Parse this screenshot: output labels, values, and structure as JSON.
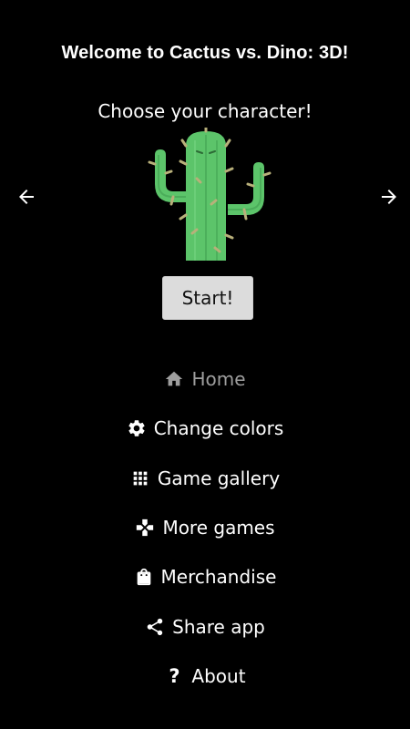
{
  "header": {
    "title": "Welcome to Cactus vs. Dino: 3D!",
    "subtitle": "Choose your character!"
  },
  "character_picker": {
    "prev_icon": "arrow-left-icon",
    "next_icon": "arrow-right-icon",
    "current_character_icon": "cactus-icon",
    "start_label": "Start!"
  },
  "menu": {
    "items": [
      {
        "label": "Home",
        "icon": "home-icon",
        "active": true
      },
      {
        "label": "Change colors",
        "icon": "gear-icon",
        "active": false
      },
      {
        "label": "Game gallery",
        "icon": "grid-icon",
        "active": false
      },
      {
        "label": "More games",
        "icon": "gamepad-icon",
        "active": false
      },
      {
        "label": "Merchandise",
        "icon": "shopping-bag-icon",
        "active": false
      },
      {
        "label": "Share app",
        "icon": "share-icon",
        "active": false
      },
      {
        "label": "About",
        "icon": "question-mark-icon",
        "active": false
      }
    ]
  },
  "colors": {
    "background": "#000000",
    "text": "#ffffff",
    "active_menu_text": "#9e9e9e",
    "button_background": "#dcdcdc",
    "cactus_green": "#5cc46a"
  }
}
